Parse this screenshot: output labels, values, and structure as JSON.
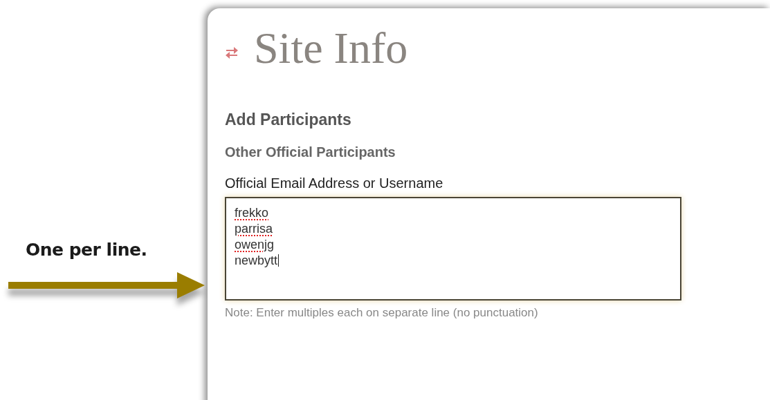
{
  "annotation": {
    "text": "One per line."
  },
  "page": {
    "title": "Site Info",
    "section": "Add Participants",
    "subsection": "Other Official Participants",
    "field_label": "Official Email Address or Username",
    "entries": [
      {
        "text": "frekko",
        "misspelled": true,
        "caret": false
      },
      {
        "text": "parrisa",
        "misspelled": true,
        "caret": false
      },
      {
        "text": "owenjg",
        "misspelled": true,
        "caret": false
      },
      {
        "text": "newbytt",
        "misspelled": false,
        "caret": true
      }
    ],
    "note": "Note: Enter multiples each on separate line (no punctuation)"
  }
}
